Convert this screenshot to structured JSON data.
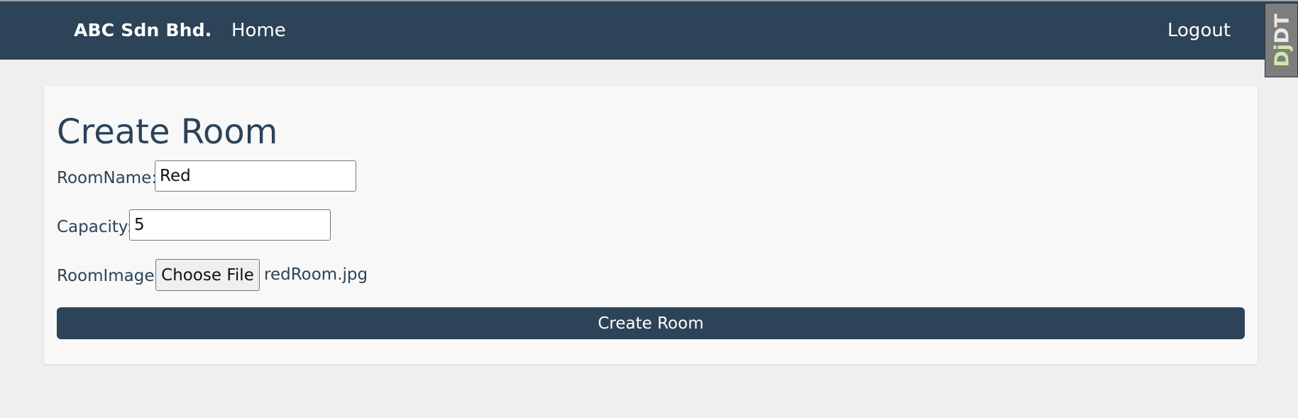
{
  "navbar": {
    "brand": "ABC Sdn Bhd.",
    "home": "Home",
    "logout": "Logout",
    "bg_color": "#2c4358"
  },
  "debug_toolbar": {
    "label_dj": "Dj",
    "label_dt": "DT"
  },
  "form": {
    "title": "Create Room",
    "room_name_label": "RoomName:",
    "room_name_value": "Red",
    "capacity_label": "Capacity:",
    "capacity_value": "5",
    "room_image_label": "RoomImage:",
    "choose_file_label": "Choose File",
    "chosen_file": "redRoom.jpg",
    "submit_label": "Create Room"
  }
}
